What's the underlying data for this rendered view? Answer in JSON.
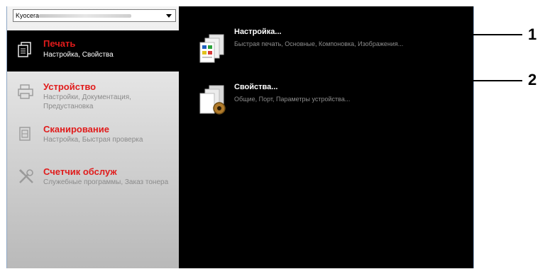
{
  "printer_select": {
    "value": "Kyocera"
  },
  "sidebar": {
    "items": [
      {
        "title": "Печать",
        "subtitle": "Настройка, Свойства"
      },
      {
        "title": "Устройство",
        "subtitle": "Настройки, Документация, Предустановка"
      },
      {
        "title": "Сканирование",
        "subtitle": "Настройка, Быстрая проверка"
      },
      {
        "title": "Счетчик обслуж",
        "subtitle": "Служебные программы, Заказ тонера"
      }
    ]
  },
  "main": {
    "entries": [
      {
        "title": "Настройка...",
        "description": "Быстрая печать, Основные, Компоновка, Изображения..."
      },
      {
        "title": "Свойства...",
        "description": "Общие, Порт, Параметры устройства..."
      }
    ]
  },
  "callouts": {
    "one": "1",
    "two": "2"
  },
  "colors": {
    "accent": "#e11b1b",
    "active_bg": "#000000"
  }
}
